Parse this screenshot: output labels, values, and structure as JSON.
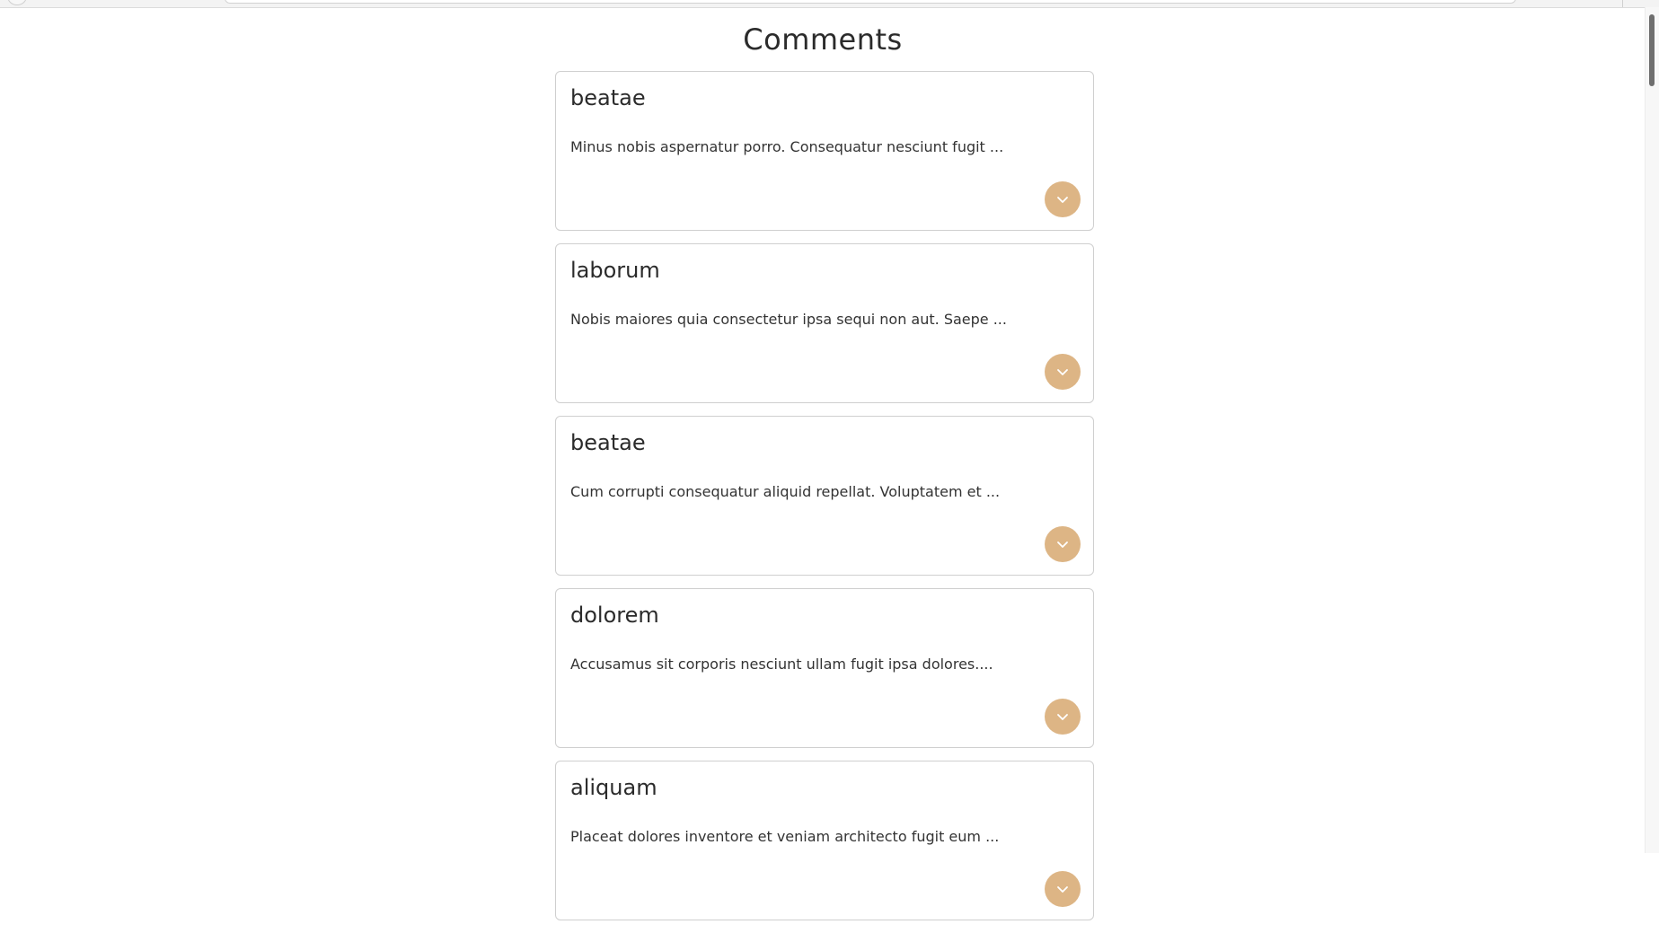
{
  "page": {
    "title": "Comments"
  },
  "comments": [
    {
      "title": "beatae",
      "body": "Minus nobis aspernatur porro. Consequatur nesciunt fugit ..."
    },
    {
      "title": "laborum",
      "body": "Nobis maiores quia consectetur ipsa sequi non aut. Saepe ..."
    },
    {
      "title": "beatae",
      "body": "Cum corrupti consequatur aliquid repellat. Voluptatem et ..."
    },
    {
      "title": "dolorem",
      "body": "Accusamus sit corporis nesciunt ullam fugit ipsa dolores...."
    },
    {
      "title": "aliquam",
      "body": "Placeat dolores inventore et veniam architecto fugit eum ..."
    }
  ],
  "icons": {
    "expand": "chevron-down-icon"
  },
  "colors": {
    "accent": "#ddb585",
    "card_border": "#cfcfcf",
    "text": "#2b2b2b",
    "background": "#ffffff"
  }
}
